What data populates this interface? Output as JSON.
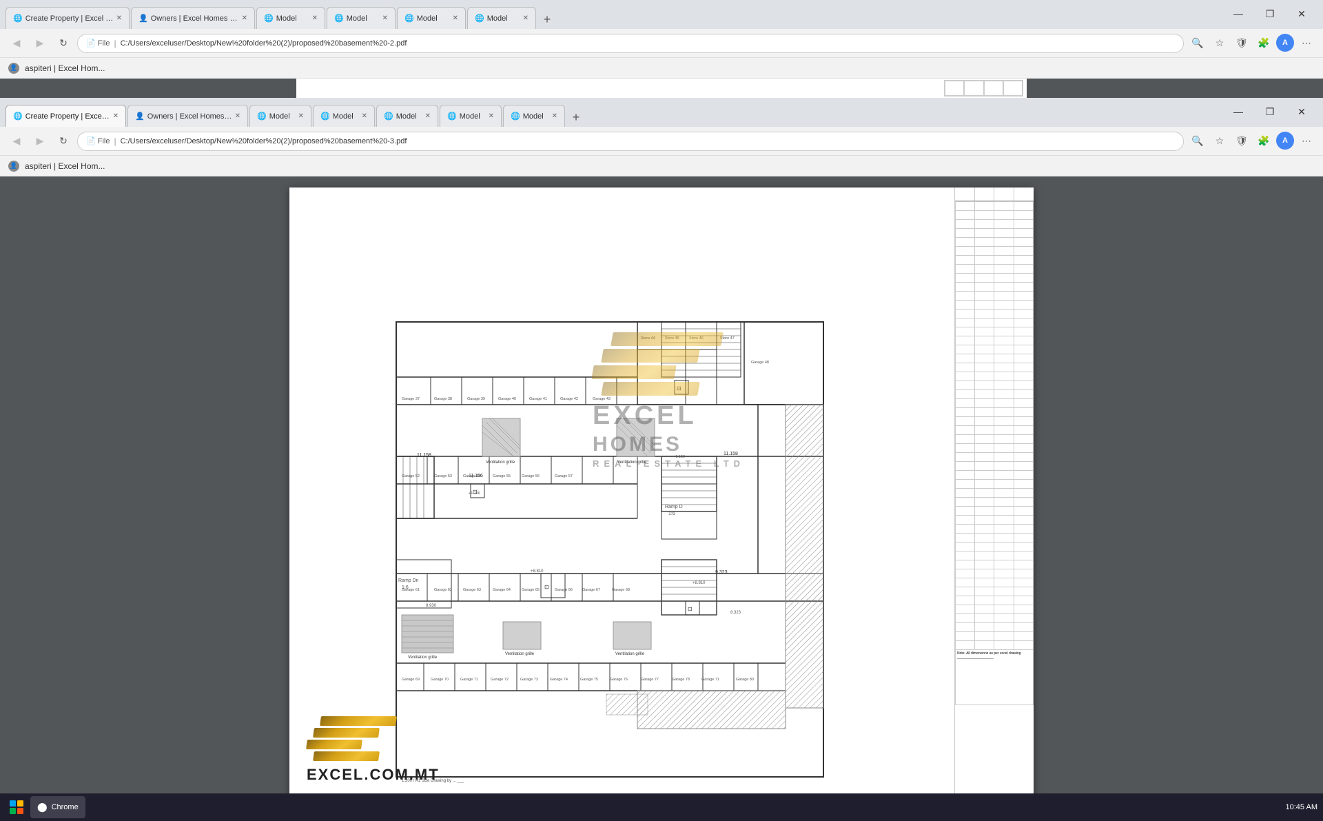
{
  "browser_top": {
    "tabs": [
      {
        "id": "tab1",
        "label": "Create Property | Excel Hom...",
        "active": false,
        "icon": "page-icon"
      },
      {
        "id": "tab2",
        "label": "Owners | Excel Homes Real Esta...",
        "active": false,
        "icon": "person-icon"
      },
      {
        "id": "tab3",
        "label": "Model",
        "active": false,
        "icon": "globe-icon"
      },
      {
        "id": "tab4",
        "label": "Model",
        "active": false,
        "icon": "globe-icon"
      },
      {
        "id": "tab5",
        "label": "Model",
        "active": false,
        "icon": "globe-icon"
      },
      {
        "id": "tab6",
        "label": "Model",
        "active": false,
        "icon": "globe-icon"
      }
    ],
    "address": "C:/Users/exceluser/Desktop/New%20folder%20(2)/proposed%20basement%20-2.pdf",
    "address_display": "File  |  C:/Users/exceluser/Desktop/New%20folder%20(2)/proposed%20basement%20-2.pdf"
  },
  "browser_bottom": {
    "tabs": [
      {
        "id": "btab1",
        "label": "Create Property | Excel Hor...",
        "active": true,
        "icon": "page-icon"
      },
      {
        "id": "btab2",
        "label": "Owners | Excel Homes Real...",
        "active": false,
        "icon": "person-icon"
      },
      {
        "id": "btab3",
        "label": "Model",
        "active": false,
        "icon": "globe-icon"
      },
      {
        "id": "btab4",
        "label": "Model",
        "active": false,
        "icon": "globe-icon"
      },
      {
        "id": "btab5",
        "label": "Model",
        "active": false,
        "icon": "globe-icon"
      },
      {
        "id": "btab6",
        "label": "Model",
        "active": false,
        "icon": "globe-icon"
      },
      {
        "id": "btab7",
        "label": "Model",
        "active": false,
        "icon": "globe-icon"
      }
    ],
    "address": "C:/Users/exceluser/Desktop/New%20folder%20(2)/proposed%20basement%20-3.pdf",
    "address_display": "File  |  C:/Users/exceluser/Desktop/New%20folder%20(2)/proposed%20basement%20-3.pdf"
  },
  "user_bar": {
    "text": "aspiteri | Excel Hom..."
  },
  "logo": {
    "brand": "EXCEL",
    "domain": "EXCEL.COM.MT",
    "sub": "REAL ESTATE LTD"
  },
  "window_controls": {
    "minimize": "—",
    "restore": "❐",
    "close": "✕"
  },
  "taskbar": {
    "time": "10:45 AM",
    "items": []
  }
}
